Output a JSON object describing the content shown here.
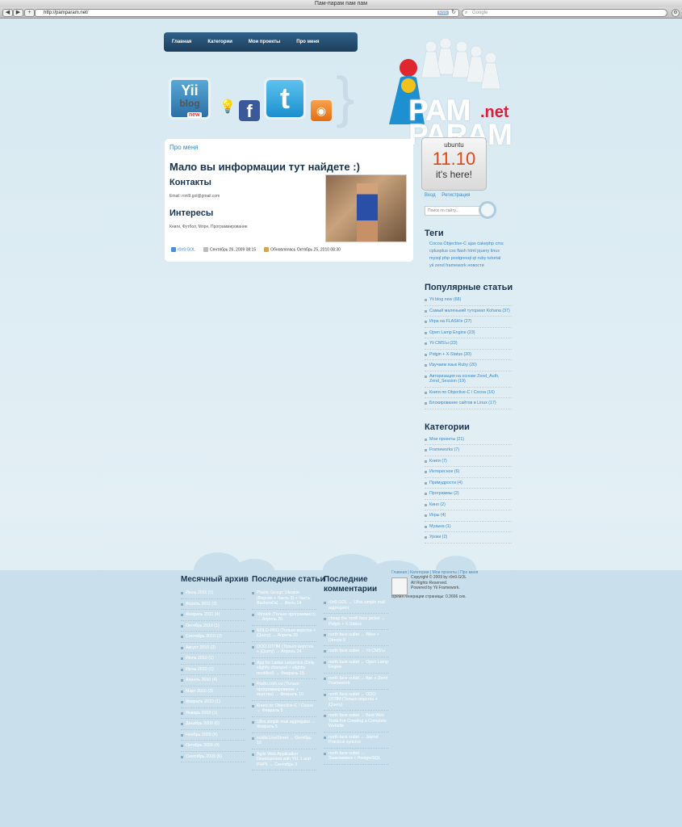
{
  "browser": {
    "title": "Пам-парам пам пам",
    "url": "http://pamparam.net/",
    "rss": "RSS",
    "search_placeholder": "Google"
  },
  "nav": [
    "Главная",
    "Категории",
    "Мои проекты",
    "Про меня"
  ],
  "logo": {
    "word1": "PAM",
    "word2": "PARAM",
    "net": ".net"
  },
  "icons": {
    "yii_big": "Yii",
    "yii_small": "blog",
    "yii_new": "new",
    "facebook": "f",
    "twitter": "t",
    "rss": "◉"
  },
  "main": {
    "crumb": "Про меня",
    "title": "Мало вы информации тут найдете :)",
    "contacts_heading": "Контакты",
    "email": "Email: ronl9.gol@gmail.com",
    "interests_heading": "Интересы",
    "interests": "Книги, Футбол, Море, Программирование",
    "meta_author": "r0n9.GOL",
    "meta_date": "Сентябрь 26, 2009 08:15",
    "meta_updated": "Обновлялась Октябрь 25, 2010 08:30"
  },
  "sidebar": {
    "ubuntu": {
      "name": "ubuntu",
      "version": "11.10",
      "tagline": "it's here!"
    },
    "login": "Вход",
    "register": "Регистрация",
    "search_placeholder": "Поиск по сайту...",
    "tags_heading": "Теги",
    "tags": "Cocoa Objective-C ajax cakephp cms cplusplus css flash html jquery linux mysql php postgresql qt ruby tutorial yii zend framework новости",
    "popular_heading": "Популярные статьи",
    "popular": [
      "Yii blog new (68)",
      "Самый маленький туториал Kohana (37)",
      "Игра на FLASH'e (27)",
      "Open Lamp Engine (23)",
      "Yii CMS'ы (23)",
      "Pidgin + X-Status (20)",
      "Изучаем язык Ruby (20)",
      "Авторизация на основе Zend_Auth, Zend_Session (19)",
      "Книги по Objective-C / Cocoa (16)",
      "Блокирование сайтов в Linux (17)"
    ],
    "categories_heading": "Категории",
    "categories": [
      "Мои проекты (21)",
      "Frameworks (7)",
      "Книги (7)",
      "Интересное (6)",
      "Примудрости (4)",
      "Программы (2)",
      "Кино (2)",
      "Игры (4)",
      "Музыка (1)",
      "Уроки (2)"
    ]
  },
  "footer": {
    "archive_heading": "Месячный архив",
    "archive": [
      "Июль 2011 (1)",
      "Апрель 2011 (3)",
      "Февраль 2011 (4)",
      "Октябрь 2010 (1)",
      "Сентябрь 2010 (2)",
      "Август 2010 (3)",
      "Июль 2010 (1)",
      "Июнь 2010 (1)",
      "Апрель 2010 (4)",
      "Март 2010 (3)",
      "Февраль 2010 (1)",
      "Январь 2010 (1)",
      "Декабрь 2009 (6)",
      "Ноябрь 2009 (6)",
      "Октябрь 2009 (4)",
      "Сентябрь 2009 (6)"
    ],
    "posts_heading": "Последние статьи",
    "posts": [
      "Plastic Group: Ukraine (Версия + Часть 3) + Часть Backend'a) → Июль 14",
      "Vitmark (Только программист) → Апрель 26",
      "B2ILD-PRO (Только верстка + jQuery) → Апрель 26",
      "ООО ОТПМ (Только верстка + jQuery) → Апрель 24",
      "App for Lanka Lekarnica (Only slightly changed + slightly modified) → Февраль 15",
      "Radio.com.ua (Только программирование + верстка) → Февраль 10",
      "Книги по Objective-C / Cocoa → Февраль 5",
      "Ultra simple mail aggregator → Февраль 5",
      "nvidia LiveStreet → Октябрь 16",
      "Agile Web Application Development with Yii1.1 and PHP5 → Сентябрь 3"
    ],
    "comments_heading": "Последние комментарии",
    "comments": [
      "r0n9.GOL → Ultra simple mail aggregator",
      "cheap the north face jacket → Pidgin + X-Status",
      "north face outlet → Wine + Directx 9",
      "north face outlet → Yii CMS'ы",
      "north face outlet → Open Lamp Engine",
      "north face outlet → Apc + Zend Framework",
      "north face outlet → ООО ОТПМ (Только верстка + jQuery)",
      "north face outlet → Best Web Tools For Creating a Complete Website",
      "north face outlet → Jskmd Practical synchro",
      "north face outlet → Знакомимся с PostgreSQL"
    ],
    "links": "Главная | Категории | Мои проекты | Про меня",
    "copyright": "Copyright © 2009 by r0n9.GOL",
    "rights": "All Rights Reserved.",
    "powered": "Powered by Yii Framework.",
    "gen_time": "Время генерации страницы: 0.3666 сек."
  }
}
